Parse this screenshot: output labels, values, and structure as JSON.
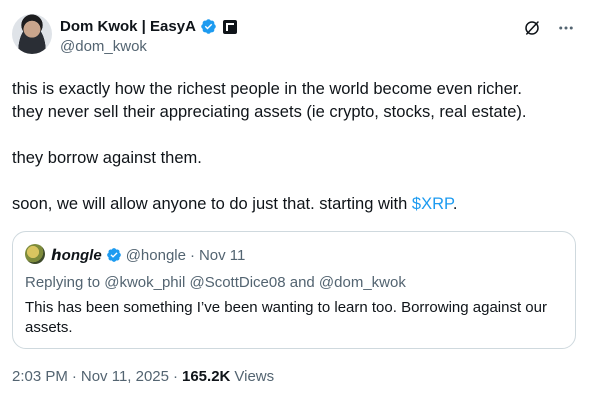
{
  "author": {
    "display_name": "Dom Kwok | EasyA",
    "handle": "@dom_kwok"
  },
  "tweet": {
    "line1": "this is exactly how the richest people in the world become even richer.",
    "line2": "they never sell their appreciating assets (ie crypto, stocks, real estate).",
    "line3": "they borrow against them.",
    "line4_prefix": "soon, we will allow anyone to do just that. starting with ",
    "cashtag": "$XRP",
    "line4_suffix": "."
  },
  "quote": {
    "display_name": "ℎongle",
    "handle": "@hongle",
    "separator": "·",
    "date": "Nov 11",
    "replying_to": "Replying to @kwok_phil @ScottDice08 and @dom_kwok",
    "text": "This has been something I’ve been wanting to learn too. Borrowing against our assets."
  },
  "footer": {
    "time": "2:03 PM",
    "sep1": "·",
    "date": "Nov 11, 2025",
    "sep2": "·",
    "views_count": "165.2K",
    "views_label": "Views"
  },
  "colors": {
    "verified": "#1d9bf0",
    "cashtag": "#1d9bf0",
    "muted": "#536471",
    "border": "#cfd9de"
  },
  "icons": {
    "verified": "verified-badge-icon",
    "affiliate": "affiliate-badge-icon",
    "grok": "grok-icon",
    "more": "more-icon"
  }
}
